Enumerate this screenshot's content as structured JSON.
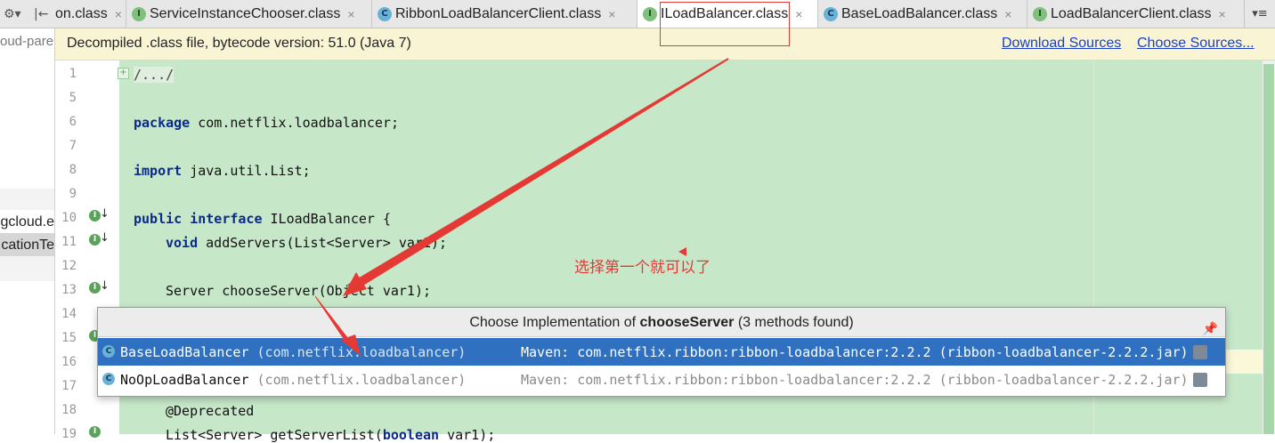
{
  "tabs": {
    "toolbar_settings_glyph": "⚙▾",
    "toolbar_collapse_glyph": "|←",
    "items": [
      {
        "label": "on.class",
        "icon": "c-class-icon",
        "kind": "c",
        "active": false
      },
      {
        "label": "ServiceInstanceChooser.class",
        "icon": "i-interface-icon",
        "kind": "i",
        "active": false
      },
      {
        "label": "RibbonLoadBalancerClient.class",
        "icon": "c-class-icon",
        "kind": "c",
        "active": false
      },
      {
        "label": "ILoadBalancer.class",
        "icon": "i-interface-icon",
        "kind": "i",
        "active": true
      },
      {
        "label": "BaseLoadBalancer.class",
        "icon": "c-class-icon",
        "kind": "c",
        "active": false
      },
      {
        "label": "LoadBalancerClient.class",
        "icon": "i-interface-icon",
        "kind": "i",
        "active": false
      }
    ],
    "close_glyph": "×",
    "overflow_glyph": "▾≡"
  },
  "left_panel": {
    "items": [
      "oud-pare",
      "gcloud.e",
      "cationTe"
    ]
  },
  "infobar": {
    "text": "Decompiled .class file, bytecode version: 51.0 (Java 7)",
    "download_sources": "Download Sources",
    "choose_sources": "Choose Sources..."
  },
  "editor": {
    "line_numbers": [
      "1",
      "5",
      "6",
      "7",
      "8",
      "9",
      "10",
      "11",
      "12",
      "13",
      "14",
      "15",
      "16",
      "17",
      "18",
      "19"
    ],
    "folded": "/.../",
    "code": {
      "package_kw": "package",
      "package_rest": " com.netflix.loadbalancer;",
      "import_kw": "import",
      "import_rest": " java.util.List;",
      "public_kw": "public",
      "interface_kw": "interface",
      "iface_rest": " ILoadBalancer {",
      "void_kw": "void",
      "add_rest": " addServers(List<Server> var1);",
      "choose_line": "Server chooseServer(Object var1);",
      "deprecated": "@Deprecated",
      "get_list_pre": "List<Server> getServerList(",
      "boolean_kw": "boolean",
      "get_list_post": " var1);"
    },
    "gutter_icon_glyph": "I",
    "gutter_arrow_glyph": "↓",
    "fold_glyph": "+"
  },
  "popup": {
    "title_prefix": "Choose Implementation of ",
    "title_method": "chooseServer",
    "title_suffix": " (3 methods found)",
    "pin_glyph": "📌",
    "rows": [
      {
        "name": "BaseLoadBalancer",
        "package": " (com.netflix.loadbalancer)",
        "maven": "Maven: com.netflix.ribbon:ribbon-loadbalancer:2.2.2 (ribbon-loadbalancer-2.2.2.jar)",
        "selected": true
      },
      {
        "name": "NoOpLoadBalancer",
        "package": " (com.netflix.loadbalancer)",
        "maven": "Maven: com.netflix.ribbon:ribbon-loadbalancer:2.2.2 (ribbon-loadbalancer-2.2.2.jar)",
        "selected": false
      }
    ],
    "row_icon_glyph": "C"
  },
  "annotation": {
    "text": "选择第一个就可以了",
    "color": "#e53935"
  },
  "colors": {
    "editor_bg": "#c7e7c9",
    "infobar_bg": "#f9f5d4",
    "selection": "#2f71c0",
    "link": "#1a3fc2",
    "keyword": "#0b2a8a"
  }
}
